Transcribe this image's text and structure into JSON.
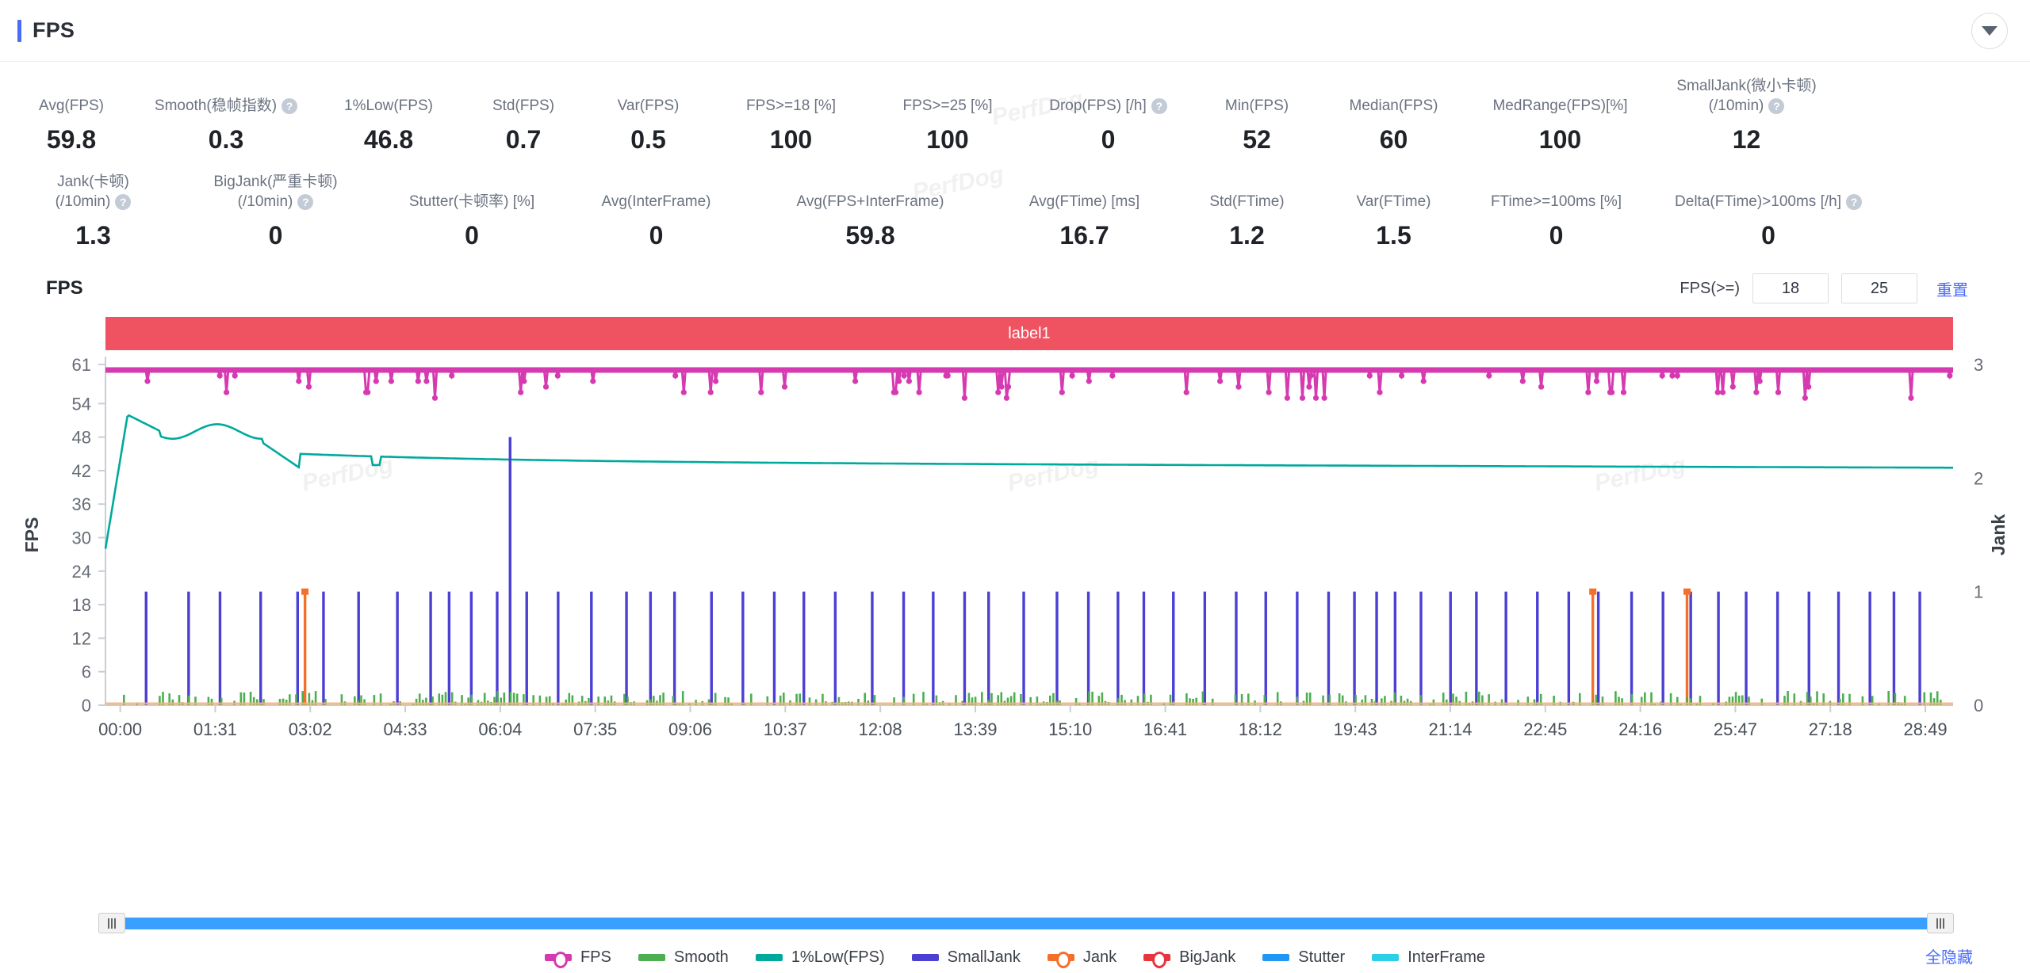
{
  "header": {
    "title": "FPS",
    "collapse_icon": "chevron-down-icon"
  },
  "stats": {
    "row1": [
      {
        "label": "Avg(FPS)",
        "value": "59.8",
        "help": false
      },
      {
        "label": "Smooth(稳帧指数)",
        "value": "0.3",
        "help": true
      },
      {
        "label": "1%Low(FPS)",
        "value": "46.8",
        "help": false
      },
      {
        "label": "Std(FPS)",
        "value": "0.7",
        "help": false
      },
      {
        "label": "Var(FPS)",
        "value": "0.5",
        "help": false
      },
      {
        "label": "FPS>=18 [%]",
        "value": "100",
        "help": false
      },
      {
        "label": "FPS>=25 [%]",
        "value": "100",
        "help": false
      },
      {
        "label": "Drop(FPS) [/h]",
        "value": "0",
        "help": true
      },
      {
        "label": "Min(FPS)",
        "value": "52",
        "help": false
      },
      {
        "label": "Median(FPS)",
        "value": "60",
        "help": false
      },
      {
        "label": "MedRange(FPS)[%]",
        "value": "100",
        "help": false
      },
      {
        "label": "SmallJank(微小卡顿)",
        "label2": "(/10min)",
        "value": "12",
        "help": true
      }
    ],
    "row2": [
      {
        "label": "Jank(卡顿)",
        "label2": "(/10min)",
        "value": "1.3",
        "help": true
      },
      {
        "label": "BigJank(严重卡顿)",
        "label2": "(/10min)",
        "value": "0",
        "help": true
      },
      {
        "label": "Stutter(卡顿率) [%]",
        "value": "0",
        "help": false
      },
      {
        "label": "Avg(InterFrame)",
        "value": "0",
        "help": false
      },
      {
        "label": "Avg(FPS+InterFrame)",
        "value": "59.8",
        "help": false
      },
      {
        "label": "Avg(FTime) [ms]",
        "value": "16.7",
        "help": false
      },
      {
        "label": "Std(FTime)",
        "value": "1.2",
        "help": false
      },
      {
        "label": "Var(FTime)",
        "value": "1.5",
        "help": false
      },
      {
        "label": "FTime>=100ms [%]",
        "value": "0",
        "help": false
      },
      {
        "label": "Delta(FTime)>100ms [/h]",
        "value": "0",
        "help": true
      }
    ]
  },
  "chart_header": {
    "title": "FPS",
    "fps_threshold_label": "FPS(>=)",
    "threshold_1": "18",
    "threshold_2": "25",
    "reset_label": "重置"
  },
  "chart_data": {
    "type": "line",
    "title": "FPS",
    "band_label": "label1",
    "xlabel": "",
    "ylabel": "FPS",
    "y2label": "Jank",
    "grid": false,
    "legend_position": "bottom",
    "yticks": [
      0,
      6,
      12,
      18,
      24,
      30,
      36,
      42,
      48,
      54,
      61
    ],
    "ylim": [
      0,
      61
    ],
    "y2ticks": [
      0,
      1,
      2,
      3
    ],
    "y2lim": [
      0,
      3
    ],
    "xticks": [
      "00:00",
      "01:31",
      "03:02",
      "04:33",
      "06:04",
      "07:35",
      "09:06",
      "10:37",
      "12:08",
      "13:39",
      "15:10",
      "16:41",
      "18:12",
      "19:43",
      "21:14",
      "22:45",
      "24:16",
      "25:47",
      "27:18",
      "28:49"
    ],
    "series": [
      {
        "name": "FPS",
        "color": "#d63ab0",
        "axis": "left",
        "avg": 59.8,
        "min": 52,
        "median": 60
      },
      {
        "name": "Smooth",
        "color": "#4caf50",
        "axis": "left",
        "avg": 0.3
      },
      {
        "name": "1%Low(FPS)",
        "color": "#00a99d",
        "axis": "left",
        "avg": 46.8
      },
      {
        "name": "SmallJank",
        "color": "#4b3fd4",
        "axis": "right",
        "avg": 12
      },
      {
        "name": "Jank",
        "color": "#f4702a",
        "axis": "right",
        "avg": 1.3
      },
      {
        "name": "BigJank",
        "color": "#e8343c",
        "axis": "right",
        "avg": 0
      },
      {
        "name": "Stutter",
        "color": "#2196f3",
        "axis": "right",
        "avg": 0
      },
      {
        "name": "InterFrame",
        "color": "#2bd0e8",
        "axis": "right",
        "avg": 0
      }
    ]
  },
  "legend": [
    {
      "label": "FPS",
      "color": "#d63ab0",
      "marker": "dotted"
    },
    {
      "label": "Smooth",
      "color": "#4caf50",
      "marker": "line"
    },
    {
      "label": "1%Low(FPS)",
      "color": "#00a99d",
      "marker": "line"
    },
    {
      "label": "SmallJank",
      "color": "#4b3fd4",
      "marker": "line"
    },
    {
      "label": "Jank",
      "color": "#f4702a",
      "marker": "dotted"
    },
    {
      "label": "BigJank",
      "color": "#e8343c",
      "marker": "dotted"
    },
    {
      "label": "Stutter",
      "color": "#2196f3",
      "marker": "line"
    },
    {
      "label": "InterFrame",
      "color": "#2bd0e8",
      "marker": "line"
    }
  ],
  "footer": {
    "hide_all_label": "全隐藏"
  },
  "watermark_text": "PerfDog",
  "colors": {
    "accent": "#4a6cf7",
    "band": "#ef5361",
    "scrollbar": "#3aa0ff"
  }
}
